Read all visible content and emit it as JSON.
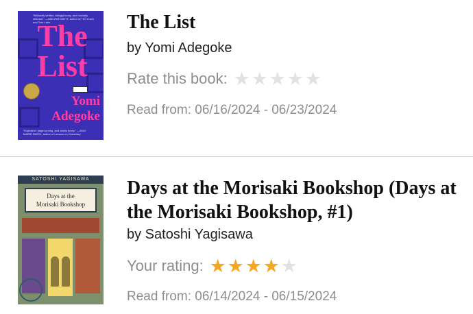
{
  "books": [
    {
      "title": "The List",
      "author": "by Yomi Adegoke",
      "rating_label": "Rate this book:",
      "stars_filled": 0,
      "stars_total": 5,
      "read_dates": "Read from: 06/16/2024 - 06/23/2024",
      "cover": {
        "title_line_1": "The",
        "title_line_2": "List",
        "author_line_1": "Yomi",
        "author_line_2": "Adegoke",
        "blurb_top": "\"Brilliantly written, bitingly funny, and crucially relevant.\" —ANN PATCHETT, author of The Dutch and Tom Lake",
        "blurb_bottom": "\"Explosive, page-turning, and darkly funny.\" —ANN MARIE SMITH, author of Lessons in Chemistry"
      }
    },
    {
      "title": "Days at the Morisaki Bookshop (Days at the Morisaki Bookshop, #1)",
      "author": "by Satoshi Yagisawa",
      "rating_label": "Your rating:",
      "stars_filled": 4,
      "stars_total": 5,
      "read_dates": "Read from: 06/14/2024 - 06/15/2024",
      "cover": {
        "author_strip": "SATOSHI YAGISAWA",
        "sign_line_1": "Days at the",
        "sign_line_2": "Morisaki Bookshop"
      }
    }
  ],
  "colors": {
    "star_on": "#f5a623",
    "star_off": "#e2e2e2",
    "muted_text": "#8d8d8d"
  }
}
